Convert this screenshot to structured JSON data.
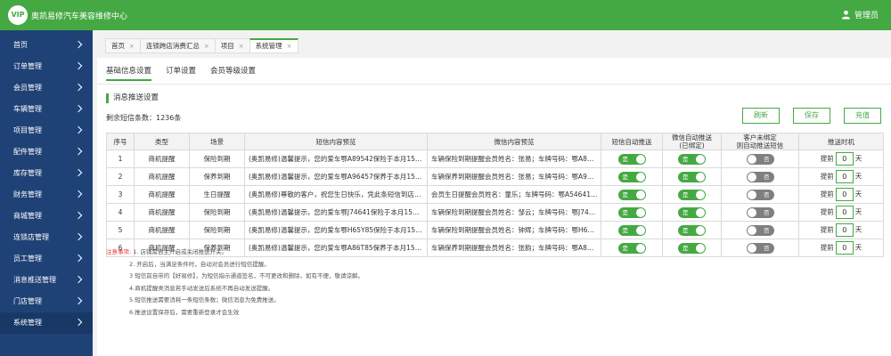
{
  "header": {
    "logo": "VIP",
    "brand": "奥凯易修汽车美容维修中心",
    "user": "管理员"
  },
  "sidebar": {
    "items": [
      {
        "label": "首页"
      },
      {
        "label": "订单管理"
      },
      {
        "label": "会员管理"
      },
      {
        "label": "车辆管理"
      },
      {
        "label": "项目管理"
      },
      {
        "label": "配件管理"
      },
      {
        "label": "库存管理"
      },
      {
        "label": "财务管理"
      },
      {
        "label": "商城管理"
      },
      {
        "label": "连锁店管理"
      },
      {
        "label": "员工管理"
      },
      {
        "label": "消息推送管理"
      },
      {
        "label": "门店管理"
      },
      {
        "label": "系统管理"
      }
    ]
  },
  "tabs": [
    {
      "label": "首页"
    },
    {
      "label": "连锁跨店消费汇总"
    },
    {
      "label": "项目"
    },
    {
      "label": "系统管理"
    }
  ],
  "subtabs": [
    {
      "label": "基础信息设置"
    },
    {
      "label": "订单设置"
    },
    {
      "label": "会员等级设置"
    }
  ],
  "section": {
    "title": "消息推送设置",
    "sms_count": "剩余短信条数：1236条"
  },
  "buttons": {
    "refresh": "刷新",
    "save": "保存",
    "recharge": "充值"
  },
  "table": {
    "headers": {
      "no": "序号",
      "type": "类型",
      "scene": "场景",
      "sms_preview": "短信内容预览",
      "wechat_preview": "微信内容预览",
      "sms_auto": "短信自动推送",
      "wechat_auto_1": "微信自动推送",
      "wechat_auto_2": "(已绑定)",
      "unbound_1": "客户未绑定",
      "unbound_2": "则自动推送短信",
      "send_time": "推送时机"
    },
    "rows": [
      {
        "no": "1",
        "type": "商机提醒",
        "scene": "保险到期",
        "sms": "(奥凯易修)温馨提示，您的爱车鄂A89542保险于本月15日...",
        "wechat": "车辆保险到期提醒会员姓名：张易；车牌号码：鄂A89542...",
        "sms_auto": "是",
        "wechat_auto": "是",
        "unbound": "否",
        "pre": "提前",
        "days": "0",
        "unit": "天"
      },
      {
        "no": "2",
        "type": "商机提醒",
        "scene": "保养到期",
        "sms": "(奥凯易修)温馨提示，您的爱车鄂A96457保养于本月15日...",
        "wechat": "车辆保养到期提醒会员姓名：张易；车牌号码：鄂A96457；...",
        "sms_auto": "是",
        "wechat_auto": "是",
        "unbound": "否",
        "pre": "提前",
        "days": "0",
        "unit": "天"
      },
      {
        "no": "3",
        "type": "商机提醒",
        "scene": "生日提醒",
        "sms": "(奥凯易修)尊敬的客户，祝您生日快乐，凭此条短信到店即...",
        "wechat": "会员生日提醒会员姓名：童乐；车牌号码：鄂A54641;提醒...",
        "sms_auto": "是",
        "wechat_auto": "是",
        "unbound": "否",
        "pre": "提前",
        "days": "0",
        "unit": "天"
      },
      {
        "no": "4",
        "type": "商机提醒",
        "scene": "保险到期",
        "sms": "(奥凯易修)温馨提示，您的爱车鄂J74641保险于本月15日...",
        "wechat": "车辆保险到期提醒会员姓名：邹云；车牌号码：鄂J74641...",
        "sms_auto": "是",
        "wechat_auto": "是",
        "unbound": "否",
        "pre": "提前",
        "days": "0",
        "unit": "天"
      },
      {
        "no": "5",
        "type": "商机提醒",
        "scene": "保险到期",
        "sms": "(奥凯易修)温馨提示，您的爱车鄂H65Y85保险于本月15日...",
        "wechat": "车辆保险到期提醒会员姓名：钟辉；车牌号码：鄂H65Y85...",
        "sms_auto": "是",
        "wechat_auto": "是",
        "unbound": "否",
        "pre": "提前",
        "days": "0",
        "unit": "天"
      },
      {
        "no": "6",
        "type": "商机提醒",
        "scene": "保养到期",
        "sms": "(奥凯易修)温馨提示，您的爱车鄂A86T85保养于本月15日...",
        "wechat": "车辆保养到期提醒会员姓名：张韵；车牌号码：鄂A86T85...",
        "sms_auto": "是",
        "wechat_auto": "是",
        "unbound": "否",
        "pre": "提前",
        "days": "0",
        "unit": "天"
      }
    ]
  },
  "notes": {
    "label": "注意事项:",
    "lines": [
      "1. 店铺需自主开启或关闭推送开关。",
      "2. 开启后，当满足条件时，自动对会员进行短信提醒。",
      "3 短信前自带的【好易修】，为短信指示通道签名，不可更改和删除，如有不便，敬请谅解。",
      "4.商机提醒类消息若手动发送后系统不再自动发送提醒。",
      "5.短信推送需要消耗一条短信条数；微信消息为免费推送。",
      "6.推送设置保存后，需要重新登录才会生效"
    ]
  },
  "colors": {
    "primary": "#45a943",
    "sidebar": "#1f4276",
    "warning": "#e5383b"
  }
}
